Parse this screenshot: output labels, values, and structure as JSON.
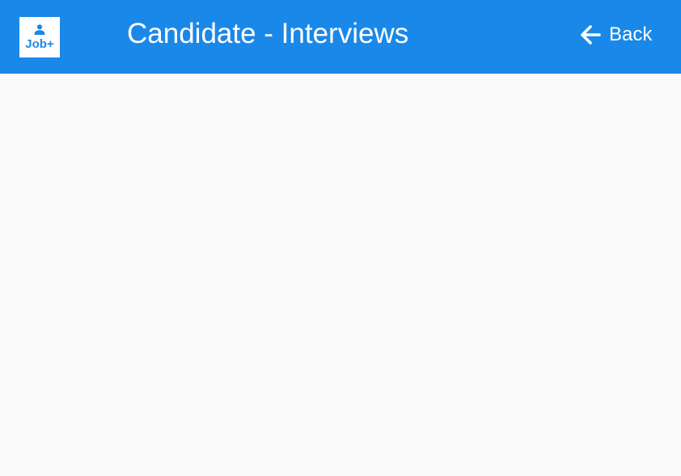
{
  "header": {
    "logo_text": "Job+",
    "logo_icon": "person-icon",
    "title": "Candidate - Interviews",
    "back_label": "Back",
    "back_icon": "arrow-left-icon"
  },
  "colors": {
    "header_background": "#1a88e8",
    "page_background": "#fafafa",
    "header_text": "#ffffff",
    "logo_background": "#ffffff",
    "logo_text": "#1a88e8"
  }
}
